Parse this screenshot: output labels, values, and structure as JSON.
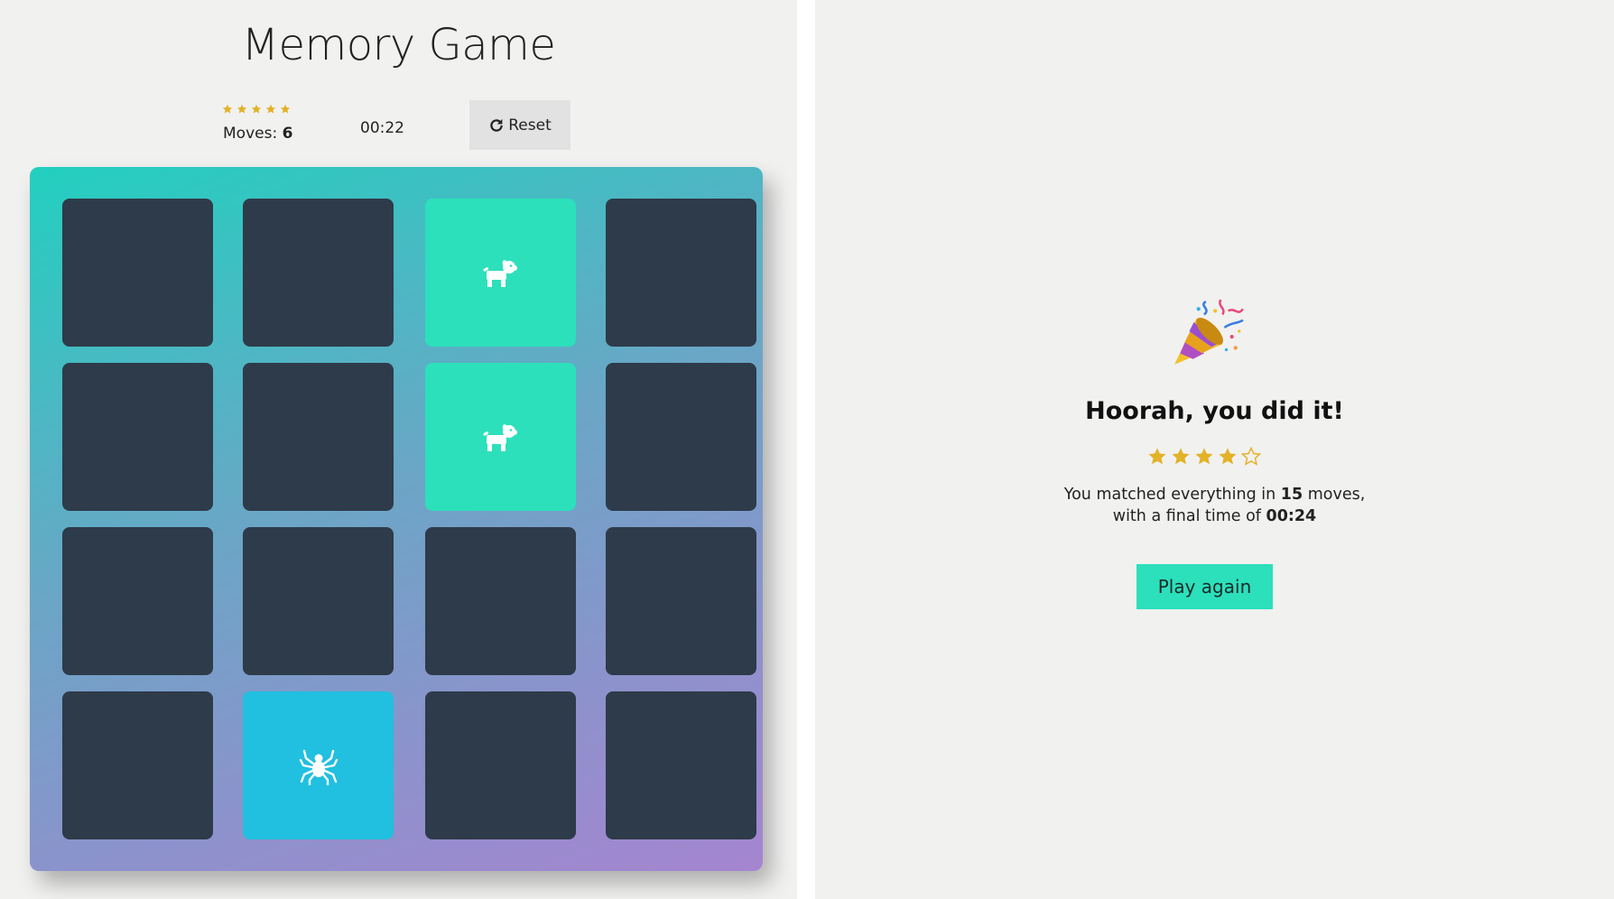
{
  "game": {
    "title": "Memory Game",
    "rating_stars": 5,
    "star_color": "#e2b227",
    "moves_label": "Moves: ",
    "moves_value": "6",
    "timer": "00:22",
    "reset_label": "Reset",
    "reset_icon": "refresh-icon",
    "colors": {
      "card_closed": "#2e3b4a",
      "card_match": "#2ce0bb",
      "card_open": "#21bfe0"
    },
    "cards": [
      {
        "state": "closed",
        "icon": ""
      },
      {
        "state": "closed",
        "icon": ""
      },
      {
        "state": "match",
        "icon": "dog-icon"
      },
      {
        "state": "closed",
        "icon": ""
      },
      {
        "state": "closed",
        "icon": ""
      },
      {
        "state": "closed",
        "icon": ""
      },
      {
        "state": "match",
        "icon": "dog-icon"
      },
      {
        "state": "closed",
        "icon": ""
      },
      {
        "state": "closed",
        "icon": ""
      },
      {
        "state": "closed",
        "icon": ""
      },
      {
        "state": "closed",
        "icon": ""
      },
      {
        "state": "closed",
        "icon": ""
      },
      {
        "state": "closed",
        "icon": ""
      },
      {
        "state": "open",
        "icon": "spider-icon"
      },
      {
        "state": "closed",
        "icon": ""
      },
      {
        "state": "closed",
        "icon": ""
      }
    ]
  },
  "modal": {
    "icon": "party-popper-icon",
    "title": "Hoorah, you did it!",
    "rating_stars_filled": 4,
    "rating_stars_total": 5,
    "text_prefix": "You matched everything in ",
    "moves_value": "15",
    "text_middle": " moves,",
    "text_line2_prefix": "with a final time of ",
    "time_value": "00:24",
    "play_again_label": "Play again"
  }
}
